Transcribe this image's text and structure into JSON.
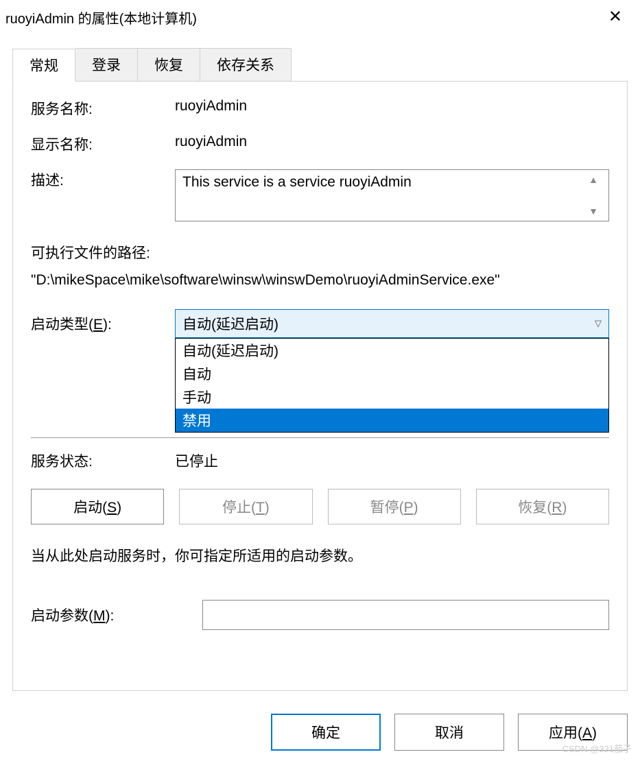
{
  "titlebar": {
    "title": "ruoyiAdmin 的属性(本地计算机)"
  },
  "tabs": [
    {
      "label": "常规",
      "active": true
    },
    {
      "label": "登录",
      "active": false
    },
    {
      "label": "恢复",
      "active": false
    },
    {
      "label": "依存关系",
      "active": false
    }
  ],
  "general": {
    "service_name_label": "服务名称:",
    "service_name_value": "ruoyiAdmin",
    "display_name_label": "显示名称:",
    "display_name_value": "ruoyiAdmin",
    "description_label": "描述:",
    "description_value": "This service is a service ruoyiAdmin",
    "exe_path_label": "可执行文件的路径:",
    "exe_path_value": "\"D:\\mikeSpace\\mike\\software\\winsw\\winswDemo\\ruoyiAdminService.exe\"",
    "startup_type_label_prefix": "启动类型(",
    "startup_type_label_key": "E",
    "startup_type_label_suffix": "):",
    "startup_type_selected": "自动(延迟启动)",
    "startup_type_options": [
      {
        "label": "自动(延迟启动)",
        "highlighted": false
      },
      {
        "label": "自动",
        "highlighted": false
      },
      {
        "label": "手动",
        "highlighted": false
      },
      {
        "label": "禁用",
        "highlighted": true
      }
    ],
    "service_status_label": "服务状态:",
    "service_status_value": "已停止",
    "buttons": {
      "start_prefix": "启动(",
      "start_key": "S",
      "start_suffix": ")",
      "stop_prefix": "停止(",
      "stop_key": "T",
      "stop_suffix": ")",
      "pause_prefix": "暂停(",
      "pause_key": "P",
      "pause_suffix": ")",
      "resume_prefix": "恢复(",
      "resume_key": "R",
      "resume_suffix": ")"
    },
    "hint": "当从此处启动服务时，你可指定所适用的启动参数。",
    "start_param_prefix": "启动参数(",
    "start_param_key": "M",
    "start_param_suffix": "):",
    "start_param_value": ""
  },
  "bottom": {
    "ok": "确定",
    "cancel": "取消",
    "apply_prefix": "应用(",
    "apply_key": "A",
    "apply_suffix": ")"
  },
  "watermark": "CSDN @321茄子"
}
